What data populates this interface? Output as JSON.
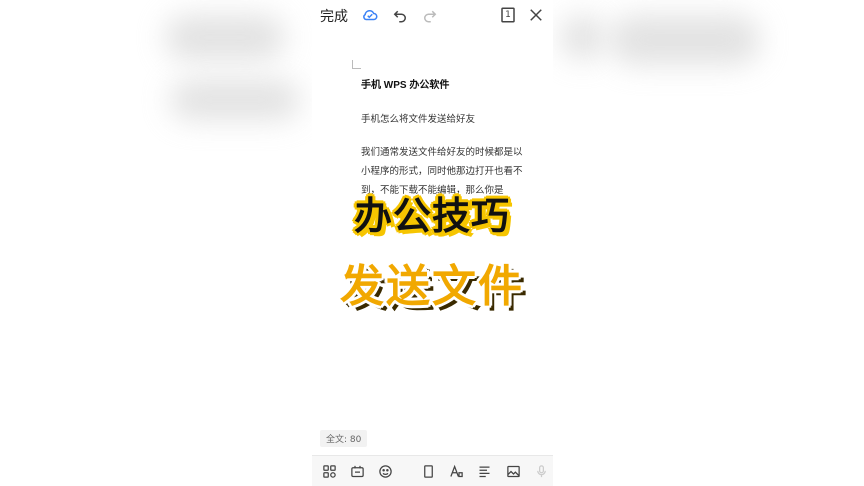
{
  "toolbar": {
    "done_label": "完成",
    "icons": [
      "cloud-sync-icon",
      "undo-icon",
      "redo-icon",
      "page-count-icon",
      "close-icon"
    ],
    "page_badge": "1"
  },
  "document": {
    "title": "手机 WPS 办公软件",
    "subtitle": "手机怎么将文件发送给好友",
    "paragraph": "我们通常发送文件给好友的时候都是以小程序的形式，同时他那边打开也看不到，不能下载不能编辑，那么你是"
  },
  "overlay": {
    "caption_1": "办公技巧",
    "caption_2": "发送文件",
    "colors": {
      "caption_1_outline": "#f6c500",
      "caption_2_fill": "#f1a800"
    }
  },
  "status": {
    "word_count": "全文: 80"
  },
  "bottom_toolbar": {
    "icons": [
      "apps-grid-icon",
      "insert-icon",
      "emoji-icon",
      "page-layout-icon",
      "font-style-icon",
      "paragraph-align-icon",
      "image-icon",
      "microphone-icon"
    ]
  }
}
